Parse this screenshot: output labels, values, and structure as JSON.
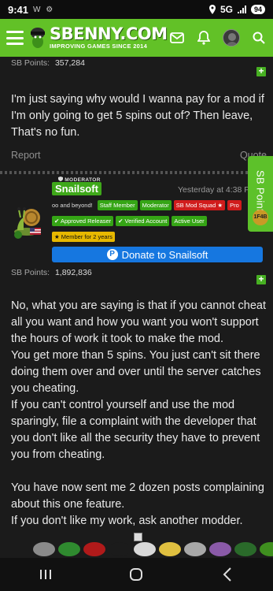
{
  "status_bar": {
    "time": "9:41",
    "left_icons": "W ⚙",
    "network": "5G",
    "battery": "94"
  },
  "app_bar": {
    "brand": "SBENNY.COM",
    "tagline": "IMPROVING GAMES SINCE 2014"
  },
  "prev_post": {
    "sb_points_label": "SB Points:",
    "sb_points_value": "357,284",
    "body": "I'm just saying why would I wanna pay for a mod if I'm only going to get 5 spins out of? Then leave, That's no fun.",
    "report_label": "Report",
    "quote_label": "Quote"
  },
  "sb_points_tab": {
    "label": "SB Points",
    "coin": "1F4B"
  },
  "post": {
    "moderator_badge": "MODERATOR",
    "username": "Snailsoft",
    "time": "Yesterday at 4:38 PM",
    "badges_row1": [
      "oo and beyond!",
      "Staff Member",
      "Moderator",
      "SB Mod Squad ★",
      "Pro"
    ],
    "badges_row2": [
      "✔ Approved Releaser",
      "✔ Verified Account",
      "Active User"
    ],
    "badges_row3": [
      "★ Member for 2 years"
    ],
    "donate_label": "Donate to Snailsoft",
    "sb_points_label": "SB Points:",
    "sb_points_value": "1,892,836",
    "paragraphs": [
      "No, what you are saying is that if you cannot cheat all you want and how you want you won't support the hours of work it took to make the mod.",
      "You get more than 5 spins. You just can't sit there doing them over and over until the server catches you cheating.",
      "If you can't control yourself and use the mod sparingly, file a complaint with the developer that you don't like all the security they have to prevent you from cheating.",
      "",
      "You have now sent me 2 dozen posts complaining about this one feature.",
      "If you don't like my work, ask another modder."
    ]
  },
  "colors": {
    "brand_green": "#62c127",
    "background": "#1b1b1b",
    "donate_blue": "#1677e0",
    "badge_red": "#d01c1c"
  }
}
